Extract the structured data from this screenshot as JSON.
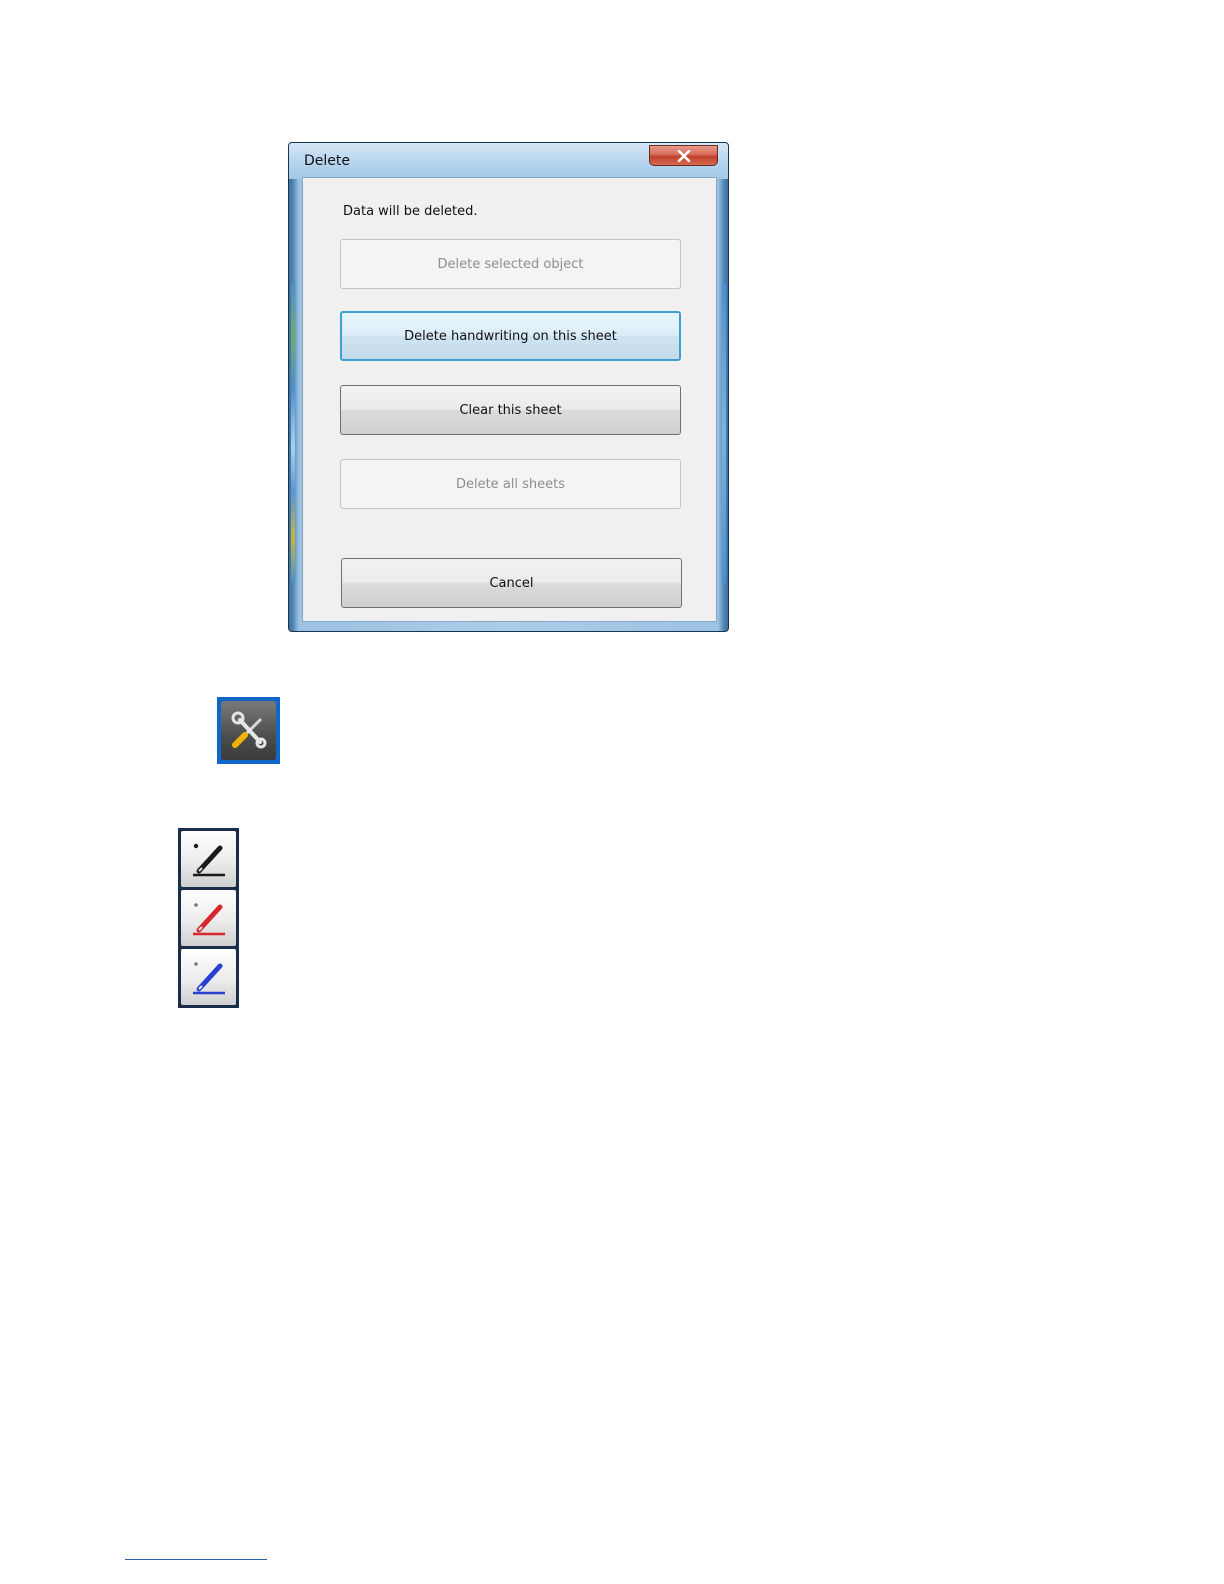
{
  "dialog": {
    "title": "Delete",
    "close_label": "×",
    "message": "Data will be deleted.",
    "buttons": {
      "delete_selected_object": "Delete selected object",
      "delete_handwriting": "Delete handwriting on this sheet",
      "clear_sheet": "Clear this sheet",
      "delete_all_sheets": "Delete all sheets",
      "cancel": "Cancel"
    }
  },
  "icons": {
    "tools": "tools-icon",
    "pens": [
      {
        "name": "black-pen-icon",
        "color": "#1a1a1a"
      },
      {
        "name": "red-pen-icon",
        "color": "#d8262e"
      },
      {
        "name": "blue-pen-icon",
        "color": "#2740d0"
      }
    ]
  },
  "colors": {
    "focus_border": "#3c9fd4",
    "close_button": "#c0402b",
    "tools_background": "#1167c5"
  }
}
